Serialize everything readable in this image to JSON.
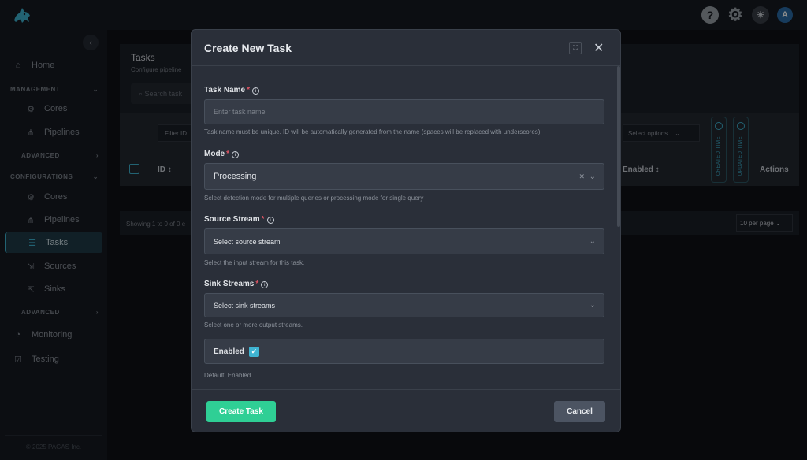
{
  "topbar": {
    "help_icon": "?",
    "gear_icon": "⚙",
    "theme_icon": "☀",
    "avatar": "A"
  },
  "sidebar": {
    "home": "Home",
    "management": "MANAGEMENT",
    "mgmt_cores": "Cores",
    "mgmt_pipelines": "Pipelines",
    "mgmt_advanced": "ADVANCED",
    "configurations": "CONFIGURATIONS",
    "cfg_cores": "Cores",
    "cfg_pipelines": "Pipelines",
    "cfg_tasks": "Tasks",
    "cfg_sources": "Sources",
    "cfg_sinks": "Sinks",
    "cfg_advanced": "ADVANCED",
    "monitoring": "Monitoring",
    "testing": "Testing",
    "footer": "© 2025 PAGAS Inc."
  },
  "background": {
    "title": "Tasks",
    "subtitle": "Configure pipeline",
    "search_placeholder": "Search task",
    "filter_id": "Filter ID",
    "col_id": "ID",
    "select_options": "Select options...",
    "col_enabled": "Enabled",
    "created_time": "CREATED TIME",
    "updated_time": "UPDATED TIME",
    "col_actions": "Actions",
    "showing": "Showing 1 to 0 of 0 e",
    "per_page": "10 per page"
  },
  "modal": {
    "title": "Create New Task",
    "task_name_label": "Task Name",
    "task_name_placeholder": "Enter task name",
    "task_name_hint": "Task name must be unique. ID will be automatically generated from the name (spaces will be replaced with underscores).",
    "mode_label": "Mode",
    "mode_value": "Processing",
    "mode_hint": "Select detection mode for multiple queries or processing mode for single query",
    "source_label": "Source Stream",
    "source_value": "Select source stream",
    "source_hint": "Select the input stream for this task.",
    "sink_label": "Sink Streams",
    "sink_value": "Select sink streams",
    "sink_hint": "Select one or more output streams.",
    "enabled_label": "Enabled",
    "enabled_checked": true,
    "enabled_hint": "Default: Enabled",
    "create_button": "Create Task",
    "cancel_button": "Cancel",
    "required_mark": "*"
  },
  "colors": {
    "accent": "#3fb4d2",
    "primary_button": "#2fcf95",
    "required": "#e05564"
  }
}
